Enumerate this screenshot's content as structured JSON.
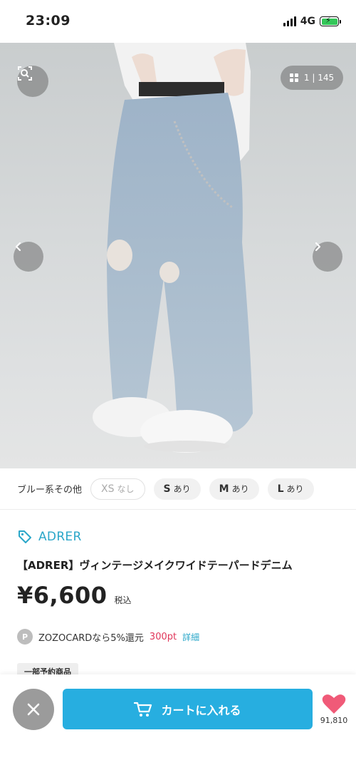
{
  "status_bar": {
    "time": "23:09",
    "network": "4G",
    "icons": [
      "signal-icon",
      "battery-charging-icon"
    ]
  },
  "gallery": {
    "counter_current": "1",
    "counter_total": "145",
    "counter_separator": "|",
    "icons": [
      "zoom-search-icon",
      "grid-icon",
      "chevron-left-icon",
      "chevron-right-icon"
    ]
  },
  "variants": {
    "color_label": "ブルー系その他",
    "sizes": [
      {
        "size": "XS",
        "stock": "なし",
        "available": false
      },
      {
        "size": "S",
        "stock": "あり",
        "available": true
      },
      {
        "size": "M",
        "stock": "あり",
        "available": true
      },
      {
        "size": "L",
        "stock": "あり",
        "available": true
      }
    ]
  },
  "product": {
    "brand": "ADRER",
    "name": "【ADRER】ヴィンテージメイクワイドテーパードデニム",
    "price": "¥6,600",
    "tax_label": "税込",
    "points_badge": "P",
    "points_text": "ZOZOCARDなら5%還元",
    "points_value": "300pt",
    "details_link": "詳細",
    "preorder_badge": "一部予約商品"
  },
  "bottom_bar": {
    "cart_label": "カートに入れる",
    "favorite_count": "91,810"
  },
  "colors": {
    "accent": "#27aee0",
    "brand": "#2ba7c9",
    "points": "#e0365a",
    "favorite": "#f05a78"
  }
}
